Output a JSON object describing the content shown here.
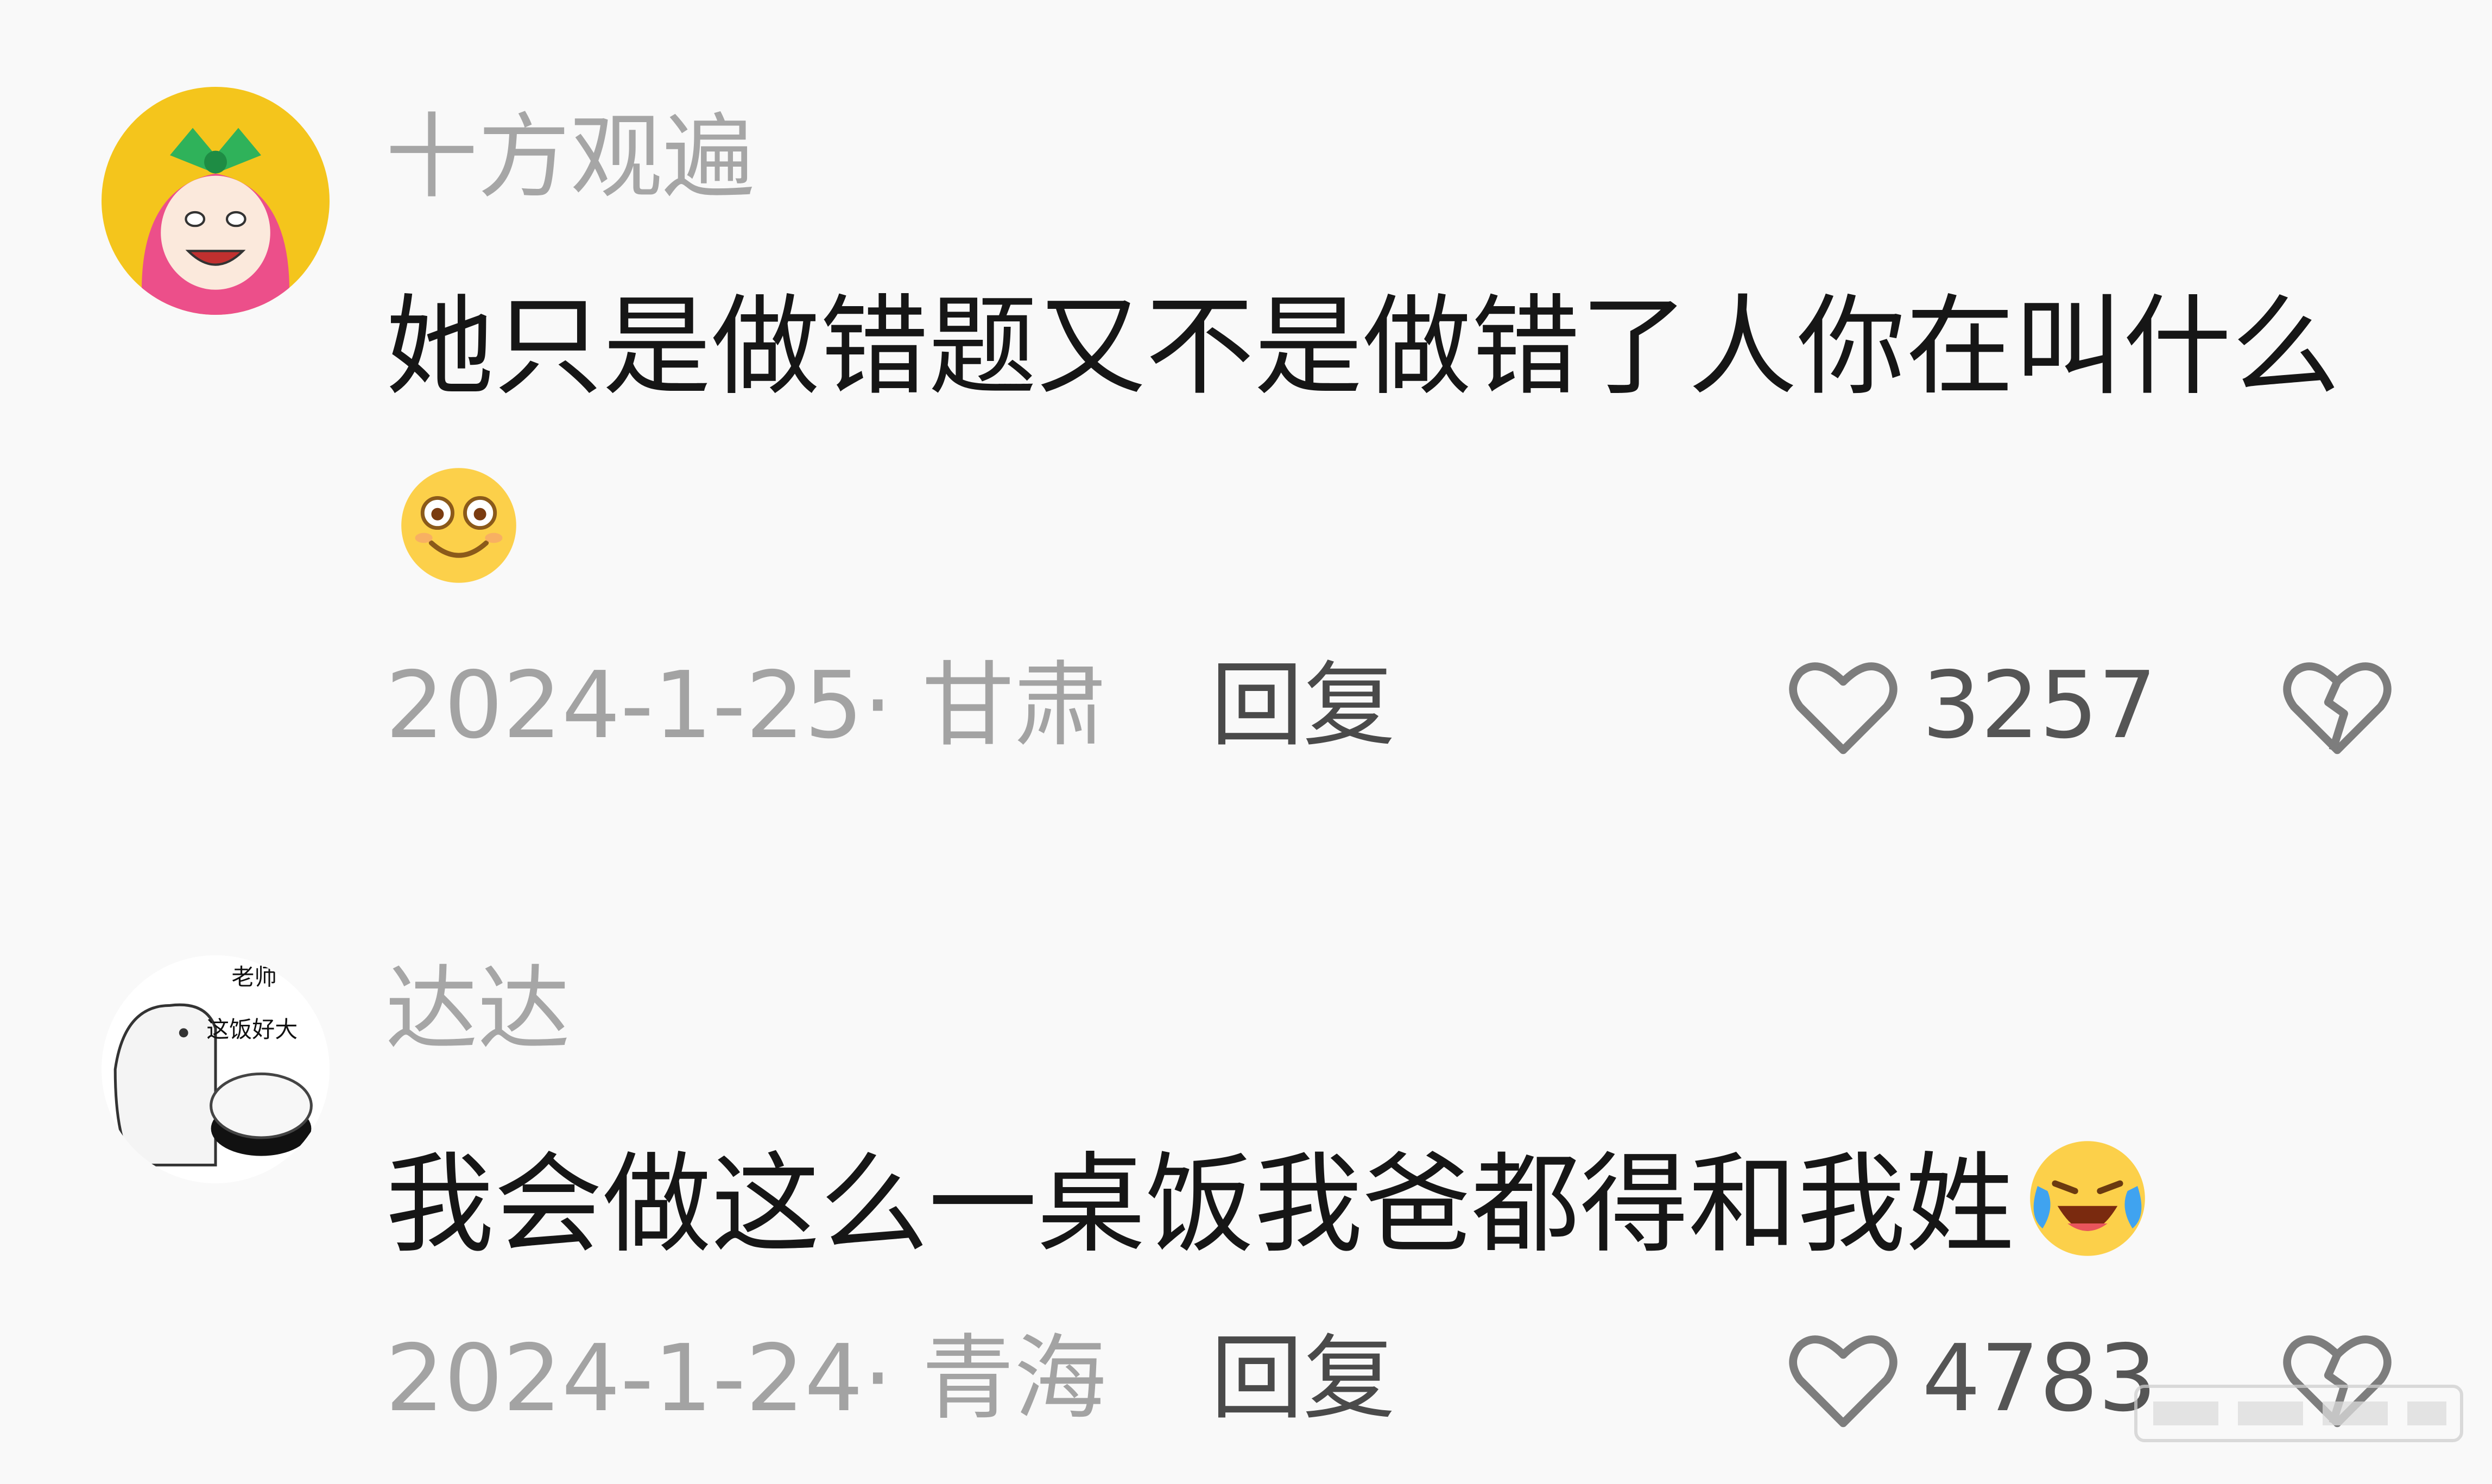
{
  "comments": [
    {
      "username": "十方观遍",
      "text": "她只是做错题又不是做错了人你在叫什么",
      "emoji": "smile-emoji",
      "date_location": "2024-1-25· 甘肃",
      "reply_label": "回复",
      "likes": "3257",
      "avatar": "girl-with-bow-avatar"
    },
    {
      "username": "达达",
      "text": "我会做这么一桌饭我爸都得和我姓",
      "emoji": "laughing-crying-emoji",
      "date_location": "2024-1-24· 青海",
      "reply_label": "回复",
      "likes": "4783",
      "avatar": "teacher-rice-meme-avatar",
      "avatar_text": [
        "老师",
        "这饭好大"
      ]
    }
  ],
  "colors": {
    "background": "#f9f9f9",
    "username": "#a6a6a6",
    "text": "#161616",
    "meta": "#a3a3a3",
    "reply": "#4a4a4a"
  },
  "icons": [
    "heart-outline-icon",
    "broken-heart-icon"
  ]
}
